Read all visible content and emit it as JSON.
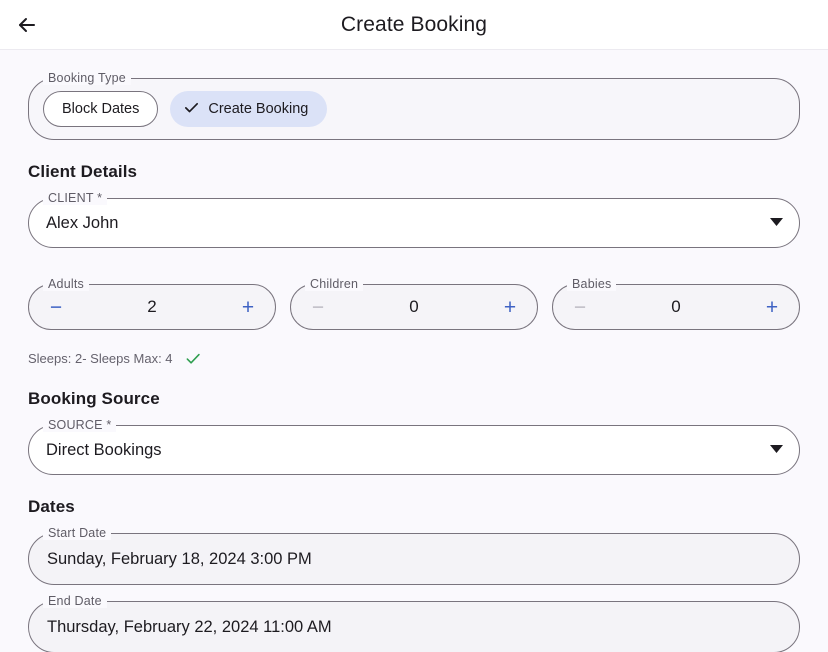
{
  "appbar": {
    "back_icon": "arrow-left-icon",
    "title": "Create Booking"
  },
  "booking_type": {
    "legend": "Booking Type",
    "options": [
      {
        "label": "Block Dates",
        "selected": false
      },
      {
        "label": "Create Booking",
        "selected": true,
        "check_icon": "check-icon"
      }
    ]
  },
  "client_details": {
    "heading": "Client Details",
    "client_select": {
      "legend": "CLIENT *",
      "value": "Alex John",
      "caret_icon": "chevron-down-icon"
    },
    "steppers": [
      {
        "legend": "Adults",
        "value": "2",
        "minus": "−",
        "plus": "+",
        "minus_disabled": false
      },
      {
        "legend": "Children",
        "value": "0",
        "minus": "−",
        "plus": "+",
        "minus_disabled": true
      },
      {
        "legend": "Babies",
        "value": "0",
        "minus": "−",
        "plus": "+",
        "minus_disabled": true
      }
    ],
    "sleeps_note": "Sleeps: 2- Sleeps Max: 4",
    "sleeps_status_icon": "check-green-icon"
  },
  "booking_source": {
    "heading": "Booking Source",
    "source_select": {
      "legend": "SOURCE *",
      "value": "Direct Bookings",
      "caret_icon": "chevron-down-icon"
    }
  },
  "dates": {
    "heading": "Dates",
    "start": {
      "legend": "Start Date",
      "value": "Sunday, February 18, 2024 3:00 PM"
    },
    "end": {
      "legend": "End Date",
      "value": "Thursday, February 22, 2024 11:00 AM"
    }
  },
  "colors": {
    "page_background": "#faf9fd",
    "appbar_background": "#ffffff",
    "selected_chip": "#dbe2f7",
    "stepper_accent": "#3f62c4",
    "stepper_disabled": "#bdbbc4",
    "field_outline": "#79747e",
    "success_green": "#2e9e4f",
    "text_primary": "#1d1b20",
    "text_secondary": "#5f5c66"
  }
}
